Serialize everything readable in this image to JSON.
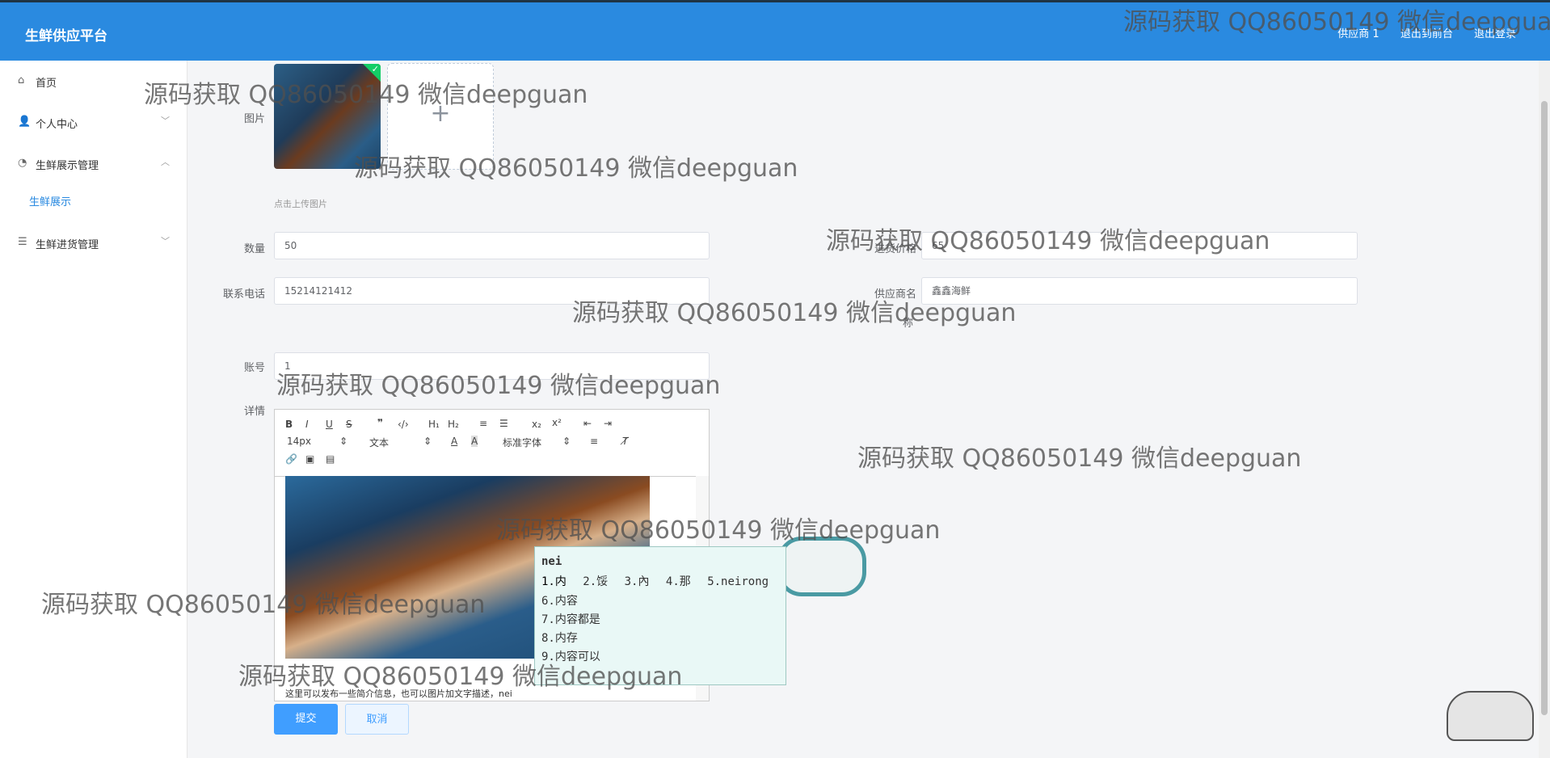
{
  "header": {
    "app_title": "生鲜供应平台",
    "user": "供应商 1",
    "back_front": "退出到前台",
    "logout": "退出登录"
  },
  "sidebar": {
    "items": [
      {
        "label": "首页",
        "icon": "home-icon"
      },
      {
        "label": "个人中心",
        "icon": "user-icon"
      },
      {
        "label": "生鲜展示管理",
        "icon": "dashboard-icon"
      },
      {
        "label": "生鲜进货管理",
        "icon": "menu-icon"
      }
    ],
    "active_sub": "生鲜展示"
  },
  "form": {
    "image_label": "图片",
    "upload_hint": "点击上传图片",
    "quantity_label": "数量",
    "quantity_value": "50",
    "price_label": "进货价格",
    "price_value": "65",
    "phone_label": "联系电话",
    "phone_value": "15214121412",
    "supplier_label_line1": "供应商名",
    "supplier_label_line2": "称",
    "supplier_value": "鑫鑫海鲜",
    "account_label": "账号",
    "account_value": "1",
    "detail_label": "详情"
  },
  "editor": {
    "font_size": "14px",
    "paragraph": "文本",
    "font_family": "标准字体",
    "text": "这里可以发布一些简介信息，也可以图片加文字描述，nei"
  },
  "buttons": {
    "submit": "提交",
    "cancel": "取消"
  },
  "ime": {
    "composition": "nei",
    "candidates": [
      "1.内",
      "2.馁",
      "3.內",
      "4.那",
      "5.neirong"
    ],
    "vertical": [
      "6.内容",
      "7.内容都是",
      "8.内存",
      "9.内容可以"
    ]
  },
  "watermark": "源码获取 QQ86050149 微信deepguan"
}
